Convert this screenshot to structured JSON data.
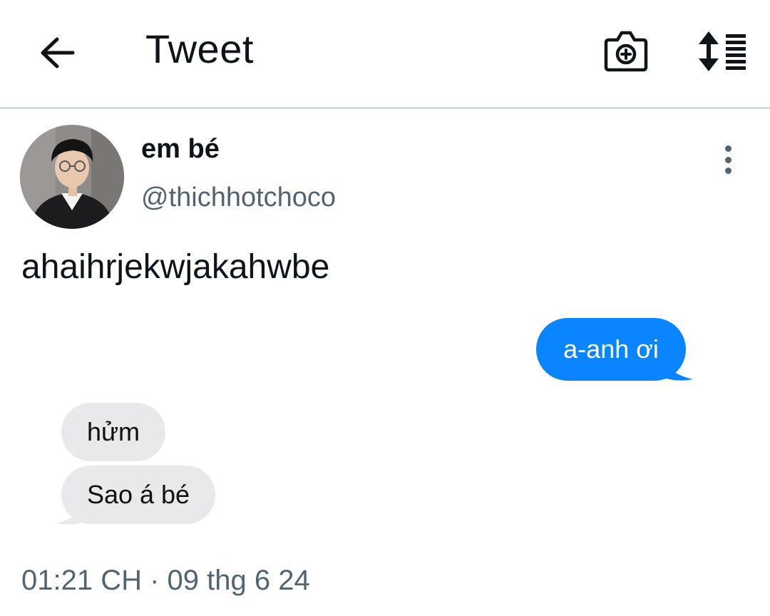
{
  "header": {
    "title": "Tweet",
    "icons": {
      "back": "arrow-left-icon",
      "camera": "camera-plus-icon",
      "sort": "sort-list-icon"
    }
  },
  "tweet": {
    "author": {
      "display_name": "em bé",
      "handle": "@thichhotchoco"
    },
    "text": "ahaihrjekwjakahwbe",
    "timestamp": "01:21 CH · 09 thg 6 24",
    "messages": [
      {
        "side": "outgoing",
        "text": "a-anh ơi",
        "color": "#0a84ff"
      },
      {
        "side": "incoming",
        "text": "hửm",
        "color": "#e9e9eb"
      },
      {
        "side": "incoming",
        "text": "Sao á bé",
        "color": "#e9e9eb"
      }
    ]
  },
  "colors": {
    "accent_blue": "#0a84ff",
    "secondary_text": "#536471",
    "primary_text": "#0f1419"
  }
}
